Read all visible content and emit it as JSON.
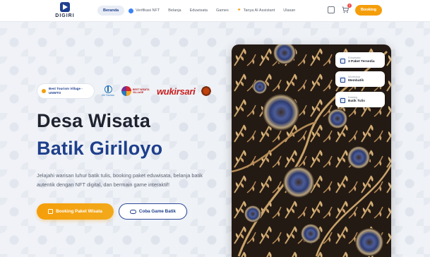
{
  "header": {
    "logo_text": "DIGIRI",
    "nav": [
      {
        "label": "Beranda",
        "active": true
      },
      {
        "label": "Verifikasi NFT",
        "icon": "nft-badge-icon"
      },
      {
        "label": "Belanja"
      },
      {
        "label": "Eduwisata"
      },
      {
        "label": "Games"
      },
      {
        "label": "Tanya AI Assistant",
        "icon": "sparkle-icon"
      },
      {
        "label": "Ulasan"
      }
    ],
    "cart_badge": "0",
    "booking_label": "Booking",
    "accent_color": "#f59e0b",
    "brand_color": "#1e3f8c"
  },
  "hero": {
    "award_pill": "Best Tourism Village - UNWTO",
    "un_tourism_label": "UN Tourism",
    "bwv_label": "BEST WISATA VILLAGE",
    "wuki_label": "wukirsari",
    "title_line1": "Desa Wisata",
    "title_line2": "Batik Giriloyo",
    "description": "Jelajahi warisan luhur batik tulis, booking paket eduwisata, belanja batik autentik dengan NFT digital, dan bermain game interaktif!",
    "primary_button": "Booking Paket Wisata",
    "secondary_button": "Coba Game Batik"
  },
  "info_cards": [
    {
      "label": "Eduwisata",
      "value": "3 Paket Tersedia",
      "icon": "book-icon"
    },
    {
      "label": "Workshop",
      "value": "Membatik",
      "icon": "brush-icon"
    },
    {
      "label": "Katalog",
      "value": "Batik Tulis",
      "icon": "catalog-icon"
    }
  ]
}
